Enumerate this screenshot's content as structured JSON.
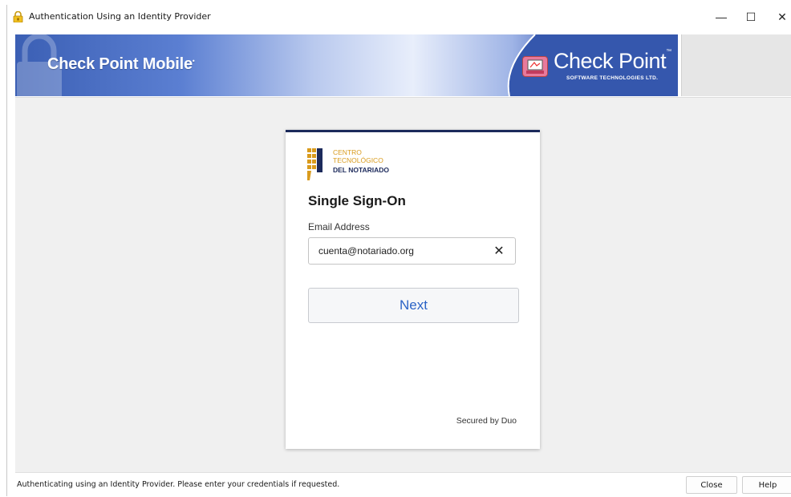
{
  "window": {
    "title": "Authentication Using an Identity Provider",
    "minimize_glyph": "—",
    "maximize_glyph": "☐",
    "close_glyph": "✕"
  },
  "banner": {
    "product": "Check Point Mobile",
    "product_mark": "•",
    "brand": "Check Point",
    "brand_mark": "™",
    "brand_sub": "SOFTWARE TECHNOLOGIES LTD."
  },
  "card": {
    "org_line1": "CENTRO",
    "org_line2": "TECNOLÓGICO",
    "org_line3": "DEL NOTARIADO",
    "title": "Single Sign-On",
    "email_label": "Email Address",
    "email_value": "cuenta@notariado.org",
    "clear_glyph": "✕",
    "next_label": "Next",
    "secured_text": "Secured by Duo"
  },
  "footer": {
    "status": "Authenticating using an Identity Provider. Please enter your credentials if requested.",
    "close_label": "Close",
    "help_label": "Help"
  },
  "colors": {
    "banner_blue": "#3b5fb4",
    "card_top_border": "#1c2a5b",
    "org_gold": "#d99b1d",
    "link_blue": "#2b63c6"
  },
  "icons": [
    "lock-icon",
    "checkpoint-logo-icon",
    "org-logo-icon",
    "clear-icon"
  ]
}
